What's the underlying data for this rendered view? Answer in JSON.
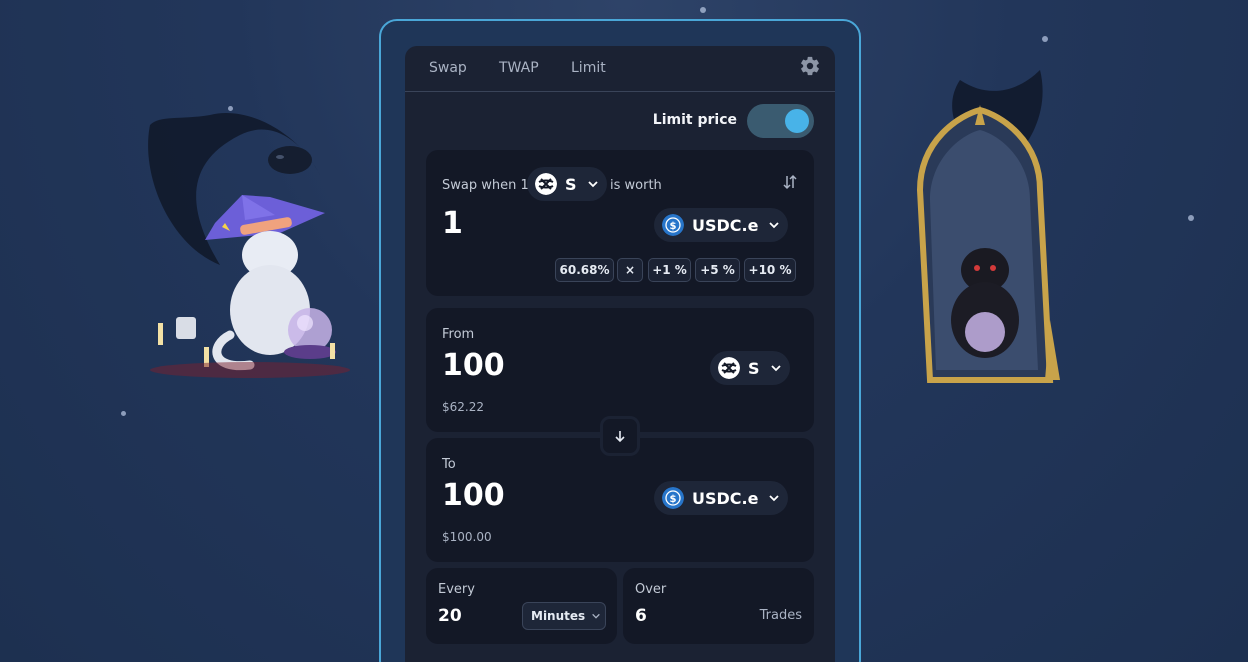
{
  "tabs": [
    {
      "label": "Swap"
    },
    {
      "label": "TWAP"
    },
    {
      "label": "Limit"
    }
  ],
  "limit_toggle": {
    "label": "Limit price",
    "on": true
  },
  "limit_card": {
    "prefix": "Swap when 1",
    "base_token": "S",
    "suffix": "is worth",
    "price": "1",
    "quote_token": "USDC.e",
    "percent_buttons": [
      "60.68%",
      "×",
      "+1 %",
      "+5 %",
      "+10 %"
    ]
  },
  "from": {
    "label": "From",
    "amount": "100",
    "token": "S",
    "usd": "$62.22"
  },
  "to": {
    "label": "To",
    "amount": "100",
    "token": "USDC.e",
    "usd": "$100.00"
  },
  "every": {
    "label": "Every",
    "value": "20",
    "unit": "Minutes"
  },
  "over": {
    "label": "Over",
    "value": "6",
    "unit": "Trades"
  },
  "colors": {
    "accent": "#48b3e8",
    "usdc": "#2775ca",
    "panel": "#1b2233",
    "card": "#131826"
  }
}
